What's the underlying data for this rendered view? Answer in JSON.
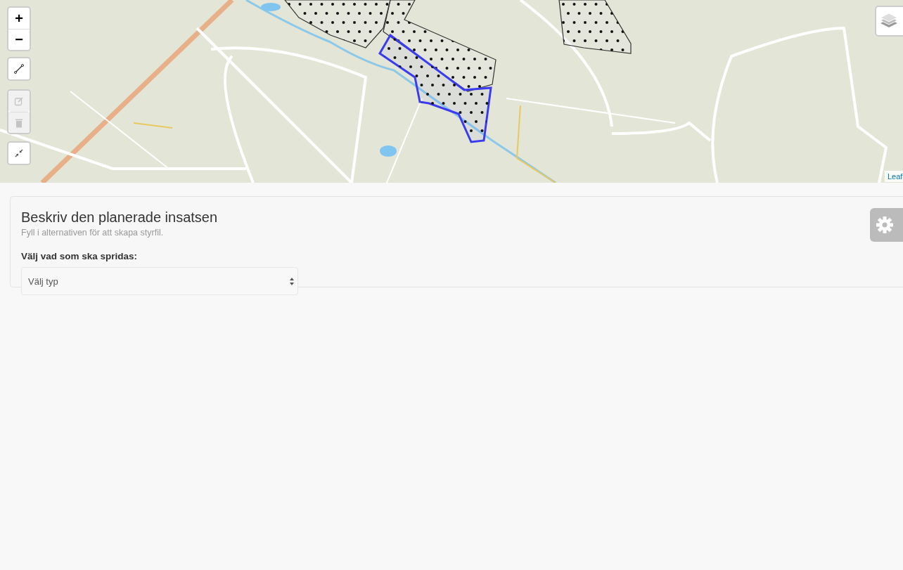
{
  "map": {
    "zoom": {
      "zoom_in": "+",
      "zoom_out": "−"
    },
    "tools": [
      {
        "kind": "line",
        "disabled": false
      },
      {
        "kind": "edit",
        "disabled": true
      },
      {
        "kind": "delete",
        "disabled": true
      },
      {
        "kind": "collapse",
        "disabled": false
      }
    ],
    "polygons": [
      {
        "selected": false
      },
      {
        "selected": false
      },
      {
        "selected": true
      },
      {
        "selected": false
      }
    ],
    "attribution": "Leaf"
  },
  "panel": {
    "title": "Beskriv den planerade insatsen",
    "subtitle": "Fyll i alternativen för att skapa styrfil.",
    "label": "Välj vad som ska spridas:",
    "select": {
      "placeholder": "Välj typ"
    }
  }
}
